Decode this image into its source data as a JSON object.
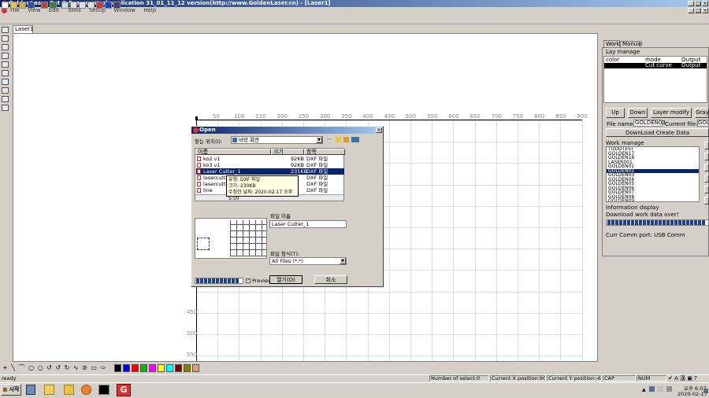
{
  "window": {
    "title": "GoldenLaser Cut & Scan control application 31_01_11_12 version(http://www.GoldenLaser.cn) - [Laser1]",
    "controls": [
      "_",
      "□",
      "×"
    ]
  },
  "menu": [
    "File",
    "View",
    "Edit",
    "Tools",
    "SetUp",
    "Window",
    "Help"
  ],
  "document_tab": "Laser1",
  "ruler": {
    "top": [
      "50",
      "100",
      "150",
      "200",
      "250",
      "300",
      "350",
      "400",
      "450",
      "500",
      "550",
      "600",
      "650",
      "700",
      "750",
      "800",
      "850",
      "900"
    ],
    "left": [
      "450",
      "500",
      "550"
    ]
  },
  "right_panel": {
    "tabs": [
      "Work",
      "Manual"
    ],
    "lay_manage_label": "Lay manage",
    "lay_columns": [
      "color",
      "mode",
      "Output"
    ],
    "lay_rows": [
      {
        "mode": "Cut curve",
        "output": "Output"
      }
    ],
    "buttons": {
      "up": "Up",
      "down": "Down",
      "layer_modify": "Layer modify",
      "gray": "Gray"
    },
    "file_name_label": "File name:",
    "file_name_value": "GOLDEN03",
    "current_file_label": "Current file:",
    "current_file_value": "GOLD",
    "download_create": "DownLoad Create Data",
    "work_manage_label": "Work manage",
    "work_items": [
      "TODDTEST",
      "GOLDEN17",
      "GOLDEN18",
      "LASER001",
      "GOLDEN01",
      "GOLDEN02",
      "GOLDEN03",
      "GOLDEN04",
      "GOLDEN05",
      "GOLDEN06",
      "GOLDEN07",
      "GOLDEN08",
      "GOLDEN09"
    ],
    "work_selected_index": 5,
    "info_label": "Information display",
    "info_text": "Download work data over!",
    "comm_port": "Curr Comm port: USB Comm"
  },
  "dialog": {
    "title": "Open",
    "look_in_label": "찾는 위치(I):",
    "look_in_value": "바탕 화면",
    "columns": [
      "이름",
      "크기",
      "항목"
    ],
    "files": [
      {
        "name": "ko2 v1",
        "size": "92KB",
        "type": "DXF 파일"
      },
      {
        "name": "ko3 v1",
        "size": "92KB",
        "type": "DXF 파일"
      },
      {
        "name": "Laser Cutter_1",
        "size": "231KB",
        "type": "DXF 파일"
      },
      {
        "name": "lasercutter2",
        "size": "",
        "type": "DXF 파일"
      },
      {
        "name": "lasercutter3",
        "size": "",
        "type": "DXF 파일"
      },
      {
        "name": "line",
        "size": "",
        "type": "DXF 파일"
      }
    ],
    "selected_index": 2,
    "tooltip": [
      "유형: DXF 파일",
      "크기: 230KB",
      "수정한 날짜: 2020-02-17 오후 5:50"
    ],
    "filename_label": "파일 이름",
    "filename_value": "Laser Cutter_1",
    "filetype_label": "파일 형식(T):",
    "filetype_value": "All Files (*.*)",
    "preview_label": "Preview",
    "open_button": "열기(O)",
    "cancel_button": "취소"
  },
  "palette": [
    "#000000",
    "#0000ff",
    "#ff0000",
    "#00c000",
    "#ff00ff",
    "#ffff00",
    "#00ffff",
    "#800000",
    "#808000",
    "#e0a070"
  ],
  "status": {
    "left": "ready",
    "selected": "Number of select:0",
    "x_pos": "Current X position:905.873",
    "y_pos": "Current Y position:-6.696",
    "cap": "CAP",
    "num": "NUM"
  },
  "taskbar": {
    "start": "시작",
    "time": "오후 6:07",
    "date": "2020-02-17"
  }
}
